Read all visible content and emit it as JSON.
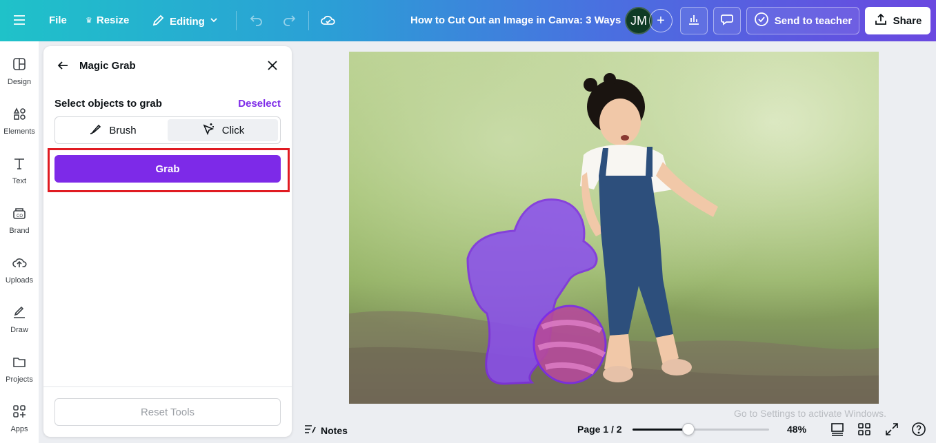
{
  "topbar": {
    "file_label": "File",
    "resize_label": "Resize",
    "editing_label": "Editing",
    "doc_title": "How to Cut Out an Image in Canva: 3 Ways",
    "avatar_initials": "JM",
    "send_label": "Send to teacher",
    "share_label": "Share"
  },
  "rail": {
    "items": [
      {
        "label": "Design"
      },
      {
        "label": "Elements"
      },
      {
        "label": "Text"
      },
      {
        "label": "Brand"
      },
      {
        "label": "Uploads"
      },
      {
        "label": "Draw"
      },
      {
        "label": "Projects"
      },
      {
        "label": "Apps"
      }
    ]
  },
  "panel": {
    "title": "Magic Grab",
    "select_label": "Select objects to grab",
    "deselect_label": "Deselect",
    "modes": [
      {
        "label": "Brush",
        "active": false
      },
      {
        "label": "Click",
        "active": true
      }
    ],
    "grab_label": "Grab",
    "reset_label": "Reset Tools"
  },
  "bottombar": {
    "notes_label": "Notes",
    "page_indicator": "Page 1 / 2",
    "zoom_label": "48%",
    "zoom_fraction": 0.41
  },
  "watermark": "Go to Settings to activate Windows.",
  "colors": {
    "accent": "#7d2ae8",
    "highlight": "#e01b22"
  }
}
